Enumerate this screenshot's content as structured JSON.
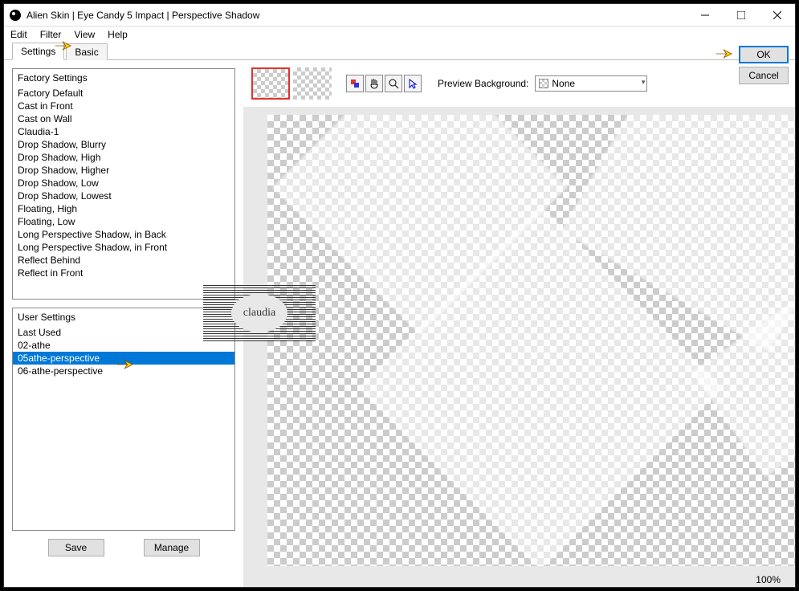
{
  "window": {
    "title": "Alien Skin | Eye Candy 5 Impact | Perspective Shadow"
  },
  "menubar": {
    "edit": "Edit",
    "filter": "Filter",
    "view": "View",
    "help": "Help"
  },
  "tabs": {
    "settings": "Settings",
    "basic": "Basic"
  },
  "factory": {
    "header": "Factory Settings",
    "items": [
      "Factory Default",
      "Cast in Front",
      "Cast on Wall",
      "Claudia-1",
      "Drop Shadow, Blurry",
      "Drop Shadow, High",
      "Drop Shadow, Higher",
      "Drop Shadow, Low",
      "Drop Shadow, Lowest",
      "Floating, High",
      "Floating, Low",
      "Long Perspective Shadow, in Back",
      "Long Perspective Shadow, in Front",
      "Reflect Behind",
      "Reflect in Front"
    ]
  },
  "user": {
    "header": "User Settings",
    "items": [
      "Last Used",
      "02-athe",
      "05athe-perspective",
      "06-athe-perspective"
    ],
    "selected_index": 2
  },
  "buttons": {
    "save": "Save",
    "manage": "Manage",
    "ok": "OK",
    "cancel": "Cancel"
  },
  "preview": {
    "background_label": "Preview Background:",
    "background_value": "None"
  },
  "zoom": "100%",
  "watermark": "claudia"
}
